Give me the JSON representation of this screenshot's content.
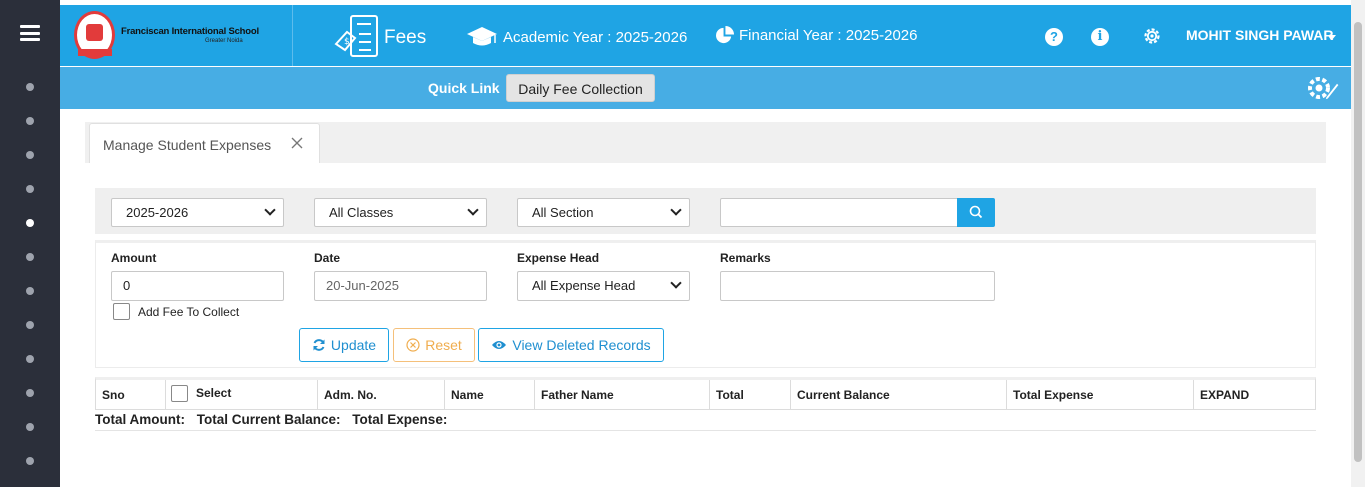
{
  "header": {
    "school_name": "Franciscan International School",
    "school_location": "Greater Noida",
    "module_label": "Fees",
    "academic_year": "Academic Year : 2025-2026",
    "financial_year": "Financial Year : 2025-2026",
    "help_symbol": "?",
    "info_symbol": "i",
    "user_name": "MOHIT SINGH PAWAR"
  },
  "quick_link": {
    "label": "Quick Link",
    "button": "Daily Fee Collection"
  },
  "tab": {
    "title": "Manage Student Expenses"
  },
  "filters": {
    "session": "2025-2026",
    "class": "All Classes",
    "section": "All Section",
    "search_value": ""
  },
  "form": {
    "amount_label": "Amount",
    "amount_value": "0",
    "date_label": "Date",
    "date_value": "20-Jun-2025",
    "expense_head_label": "Expense Head",
    "expense_head_value": "All Expense Head",
    "remarks_label": "Remarks",
    "remarks_value": "",
    "add_fee_label": "Add Fee To Collect"
  },
  "actions": {
    "update": "Update",
    "reset": "Reset",
    "view_deleted": "View Deleted Records"
  },
  "table": {
    "columns": [
      "Sno",
      "Select",
      "Adm. No.",
      "Name",
      "Father Name",
      "Total",
      "Current Balance",
      "Total Expense",
      "EXPAND"
    ]
  },
  "totals": {
    "amount": "Total Amount:",
    "current_balance": "Total Current Balance:",
    "expense": "Total Expense:"
  },
  "colors": {
    "header_blue": "#1fa4e4",
    "quickbar_blue": "#47ade4",
    "rail_dark": "#2b2f3a",
    "reset_orange": "#f0ad4e"
  },
  "icons": [
    "menu-icon",
    "school-logo",
    "fees-icon",
    "graduation-cap-icon",
    "pie-chart-icon",
    "help-icon",
    "info-icon",
    "gear-icon",
    "caret-down-icon",
    "settings-edit-icon",
    "close-icon",
    "search-icon",
    "refresh-icon",
    "reset-icon",
    "eye-icon"
  ]
}
